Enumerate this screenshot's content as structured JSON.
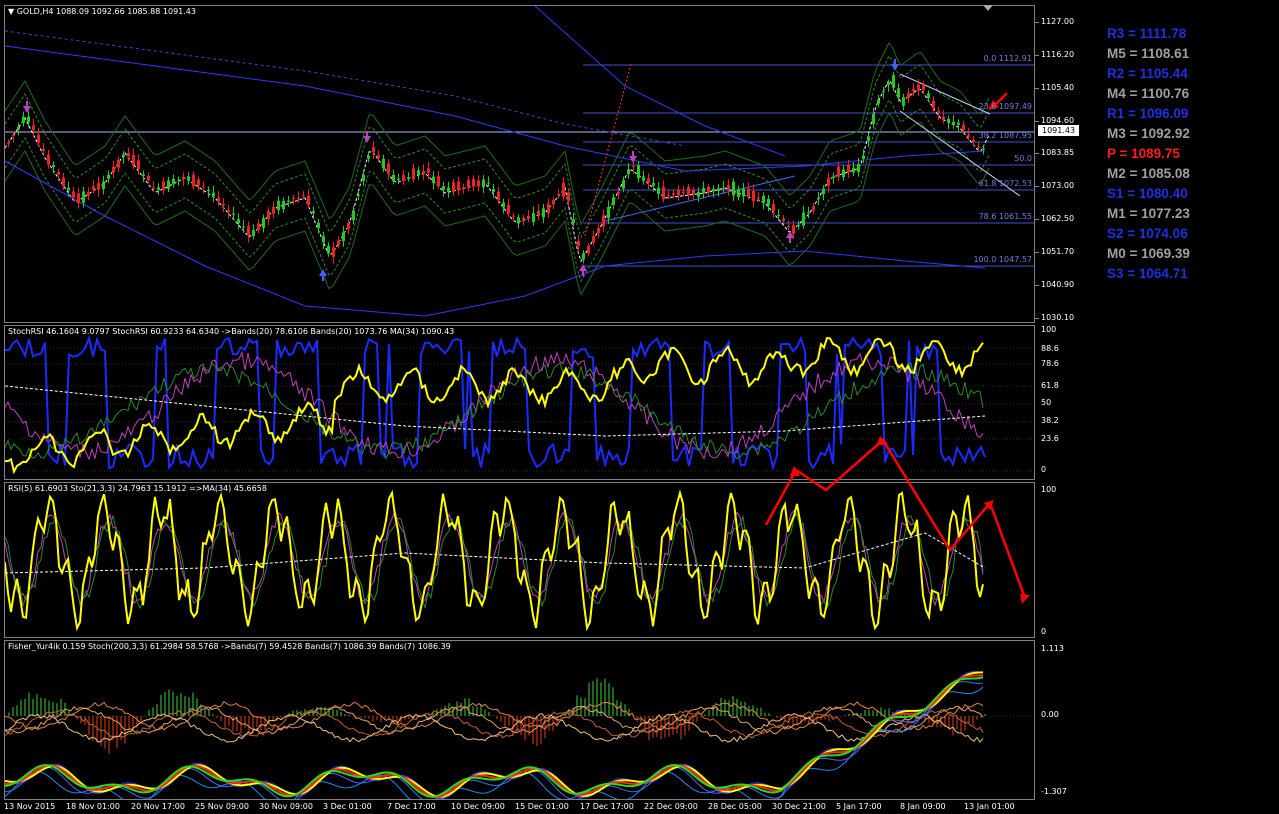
{
  "main": {
    "header": "GOLD,H4  1088.09 1092.66 1085.88 1091.43",
    "price_ticks": [
      "1127.00",
      "1116.20",
      "1105.40",
      "1094.60",
      "1083.85",
      "1073.00",
      "1062.50",
      "1051.70",
      "1040.90",
      "1030.10"
    ],
    "current_price": "1091.43",
    "fib_levels": [
      {
        "label": "0.0 1112.91"
      },
      {
        "label": "23.6 1097.49"
      },
      {
        "label": "38.2 1087.95"
      },
      {
        "label": "50.0"
      },
      {
        "label": "61.8 1072.53"
      },
      {
        "label": "78.6 1061.55"
      },
      {
        "label": "100.0 1047.57"
      }
    ],
    "pivots": [
      {
        "label": "R3 = 1111.78",
        "color": "#1f2fe0"
      },
      {
        "label": "M5 = 1108.61",
        "color": "#a0a0a0"
      },
      {
        "label": "R2 = 1105.44",
        "color": "#1f2fe0"
      },
      {
        "label": "M4 = 1100.76",
        "color": "#a0a0a0"
      },
      {
        "label": "R1 = 1096.09",
        "color": "#1f2fe0"
      },
      {
        "label": "M3 = 1092.92",
        "color": "#a0a0a0"
      },
      {
        "label": "P  = 1089.75",
        "color": "#ff1a1a"
      },
      {
        "label": "M2 = 1085.08",
        "color": "#a0a0a0"
      },
      {
        "label": "S1 = 1080.40",
        "color": "#1f2fe0"
      },
      {
        "label": "M1 = 1077.23",
        "color": "#a0a0a0"
      },
      {
        "label": "S2 = 1074.06",
        "color": "#1f2fe0"
      },
      {
        "label": "M0 = 1069.39",
        "color": "#a0a0a0"
      },
      {
        "label": "S3 = 1064.71",
        "color": "#1f2fe0"
      }
    ]
  },
  "stochrsi": {
    "header": "StochRSI 46.1604 9.0797  StochRSI 60.9233 64.6340  ->Bands(20) 78.6106  Bands(20) 1073.76  MA(34) 1090.43",
    "ticks": [
      "100",
      "88.6",
      "78.6",
      "61.8",
      "50",
      "38.2",
      "23.6",
      "0"
    ]
  },
  "rsi": {
    "header": "RSI(5) 61.6903  Sto(21,3,3) 24.7963 15.1912  =>MA(34) 45.6658",
    "ticks": [
      "100",
      "0"
    ]
  },
  "fisher": {
    "header": "Fisher_Yur4ik 0.159  Stoch(200,3,3) 61.2984 58.5768  ->Bands(7) 59.4528  Bands(7) 1086.39  Bands(7) 1086.39",
    "ticks": [
      "1.113",
      "0.00",
      "-1.307"
    ]
  },
  "xaxis": [
    "13 Nov 2015",
    "18 Nov 01:00",
    "20 Nov 17:00",
    "25 Nov 09:00",
    "30 Nov 09:00",
    "3 Dec 01:00",
    "7 Dec 17:00",
    "10 Dec 09:00",
    "15 Dec 01:00",
    "17 Dec 17:00",
    "22 Dec 09:00",
    "28 Dec 05:00",
    "30 Dec 21:00",
    "5 Jan 17:00",
    "8 Jan 09:00",
    "13 Jan 01:00"
  ],
  "colors": {
    "bull": "#22cc22",
    "bear": "#ee2222",
    "bands": "#3344ff",
    "rsi": "#ffff00",
    "arrow": "#ff0000"
  }
}
